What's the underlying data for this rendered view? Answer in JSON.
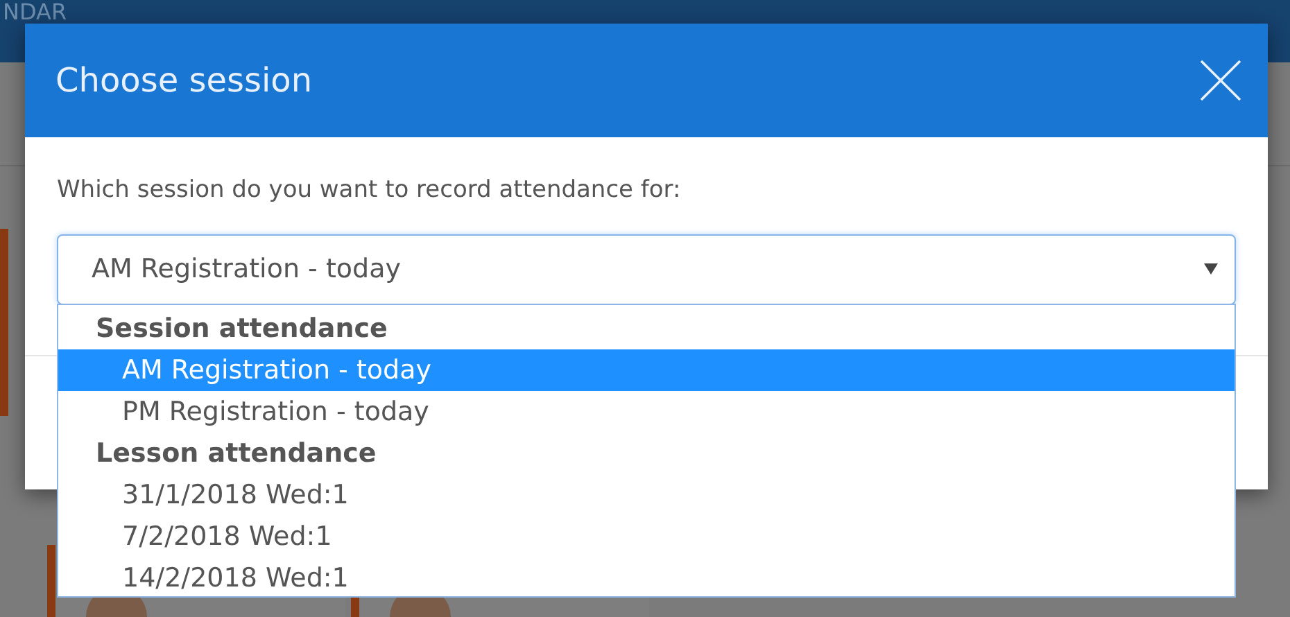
{
  "app_bar": {
    "title": "NDAR"
  },
  "dialog": {
    "title": "Choose session",
    "prompt": "Which session do you want to record attendance for:",
    "select": {
      "value": "AM Registration - today",
      "expanded": true
    },
    "dropdown": [
      {
        "kind": "group",
        "label": "Session attendance"
      },
      {
        "kind": "option",
        "label": "AM Registration - today",
        "selected": true
      },
      {
        "kind": "option",
        "label": "PM Registration - today",
        "selected": false
      },
      {
        "kind": "group",
        "label": "Lesson attendance"
      },
      {
        "kind": "option",
        "label": "31/1/2018 Wed:1",
        "selected": false
      },
      {
        "kind": "option",
        "label": "7/2/2018 Wed:1",
        "selected": false
      },
      {
        "kind": "option",
        "label": "14/2/2018 Wed:1",
        "selected": false
      }
    ]
  }
}
